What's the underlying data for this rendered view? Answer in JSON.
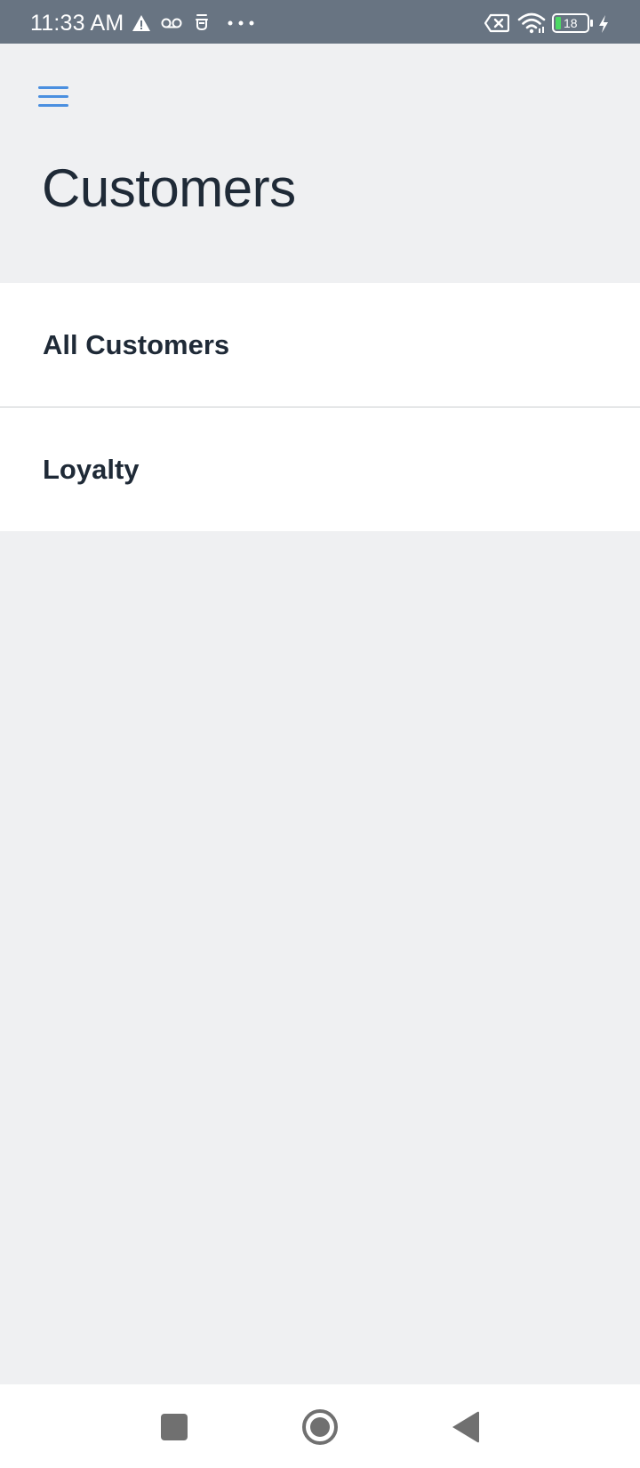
{
  "status_bar": {
    "time": "11:33 AM",
    "battery_level": "18",
    "icons": [
      "warning-icon",
      "voicemail-icon",
      "notification-icon",
      "more-dots-icon",
      "no-sim-icon",
      "wifi-icon",
      "battery-icon",
      "charging-icon"
    ]
  },
  "header": {
    "menu_icon": "hamburger-menu-icon",
    "title": "Customers"
  },
  "menu": {
    "items": [
      {
        "label": "All Customers"
      },
      {
        "label": "Loyalty"
      }
    ]
  },
  "nav_bar": {
    "buttons": [
      "recents-square-icon",
      "home-circle-icon",
      "back-triangle-icon"
    ]
  },
  "colors": {
    "status_bar": "#687482",
    "background": "#eff0f2",
    "accent": "#4a8fe0",
    "text": "#1f2a37",
    "list_background": "#ffffff",
    "divider": "#c9cccf",
    "nav_icons": "#707070"
  }
}
